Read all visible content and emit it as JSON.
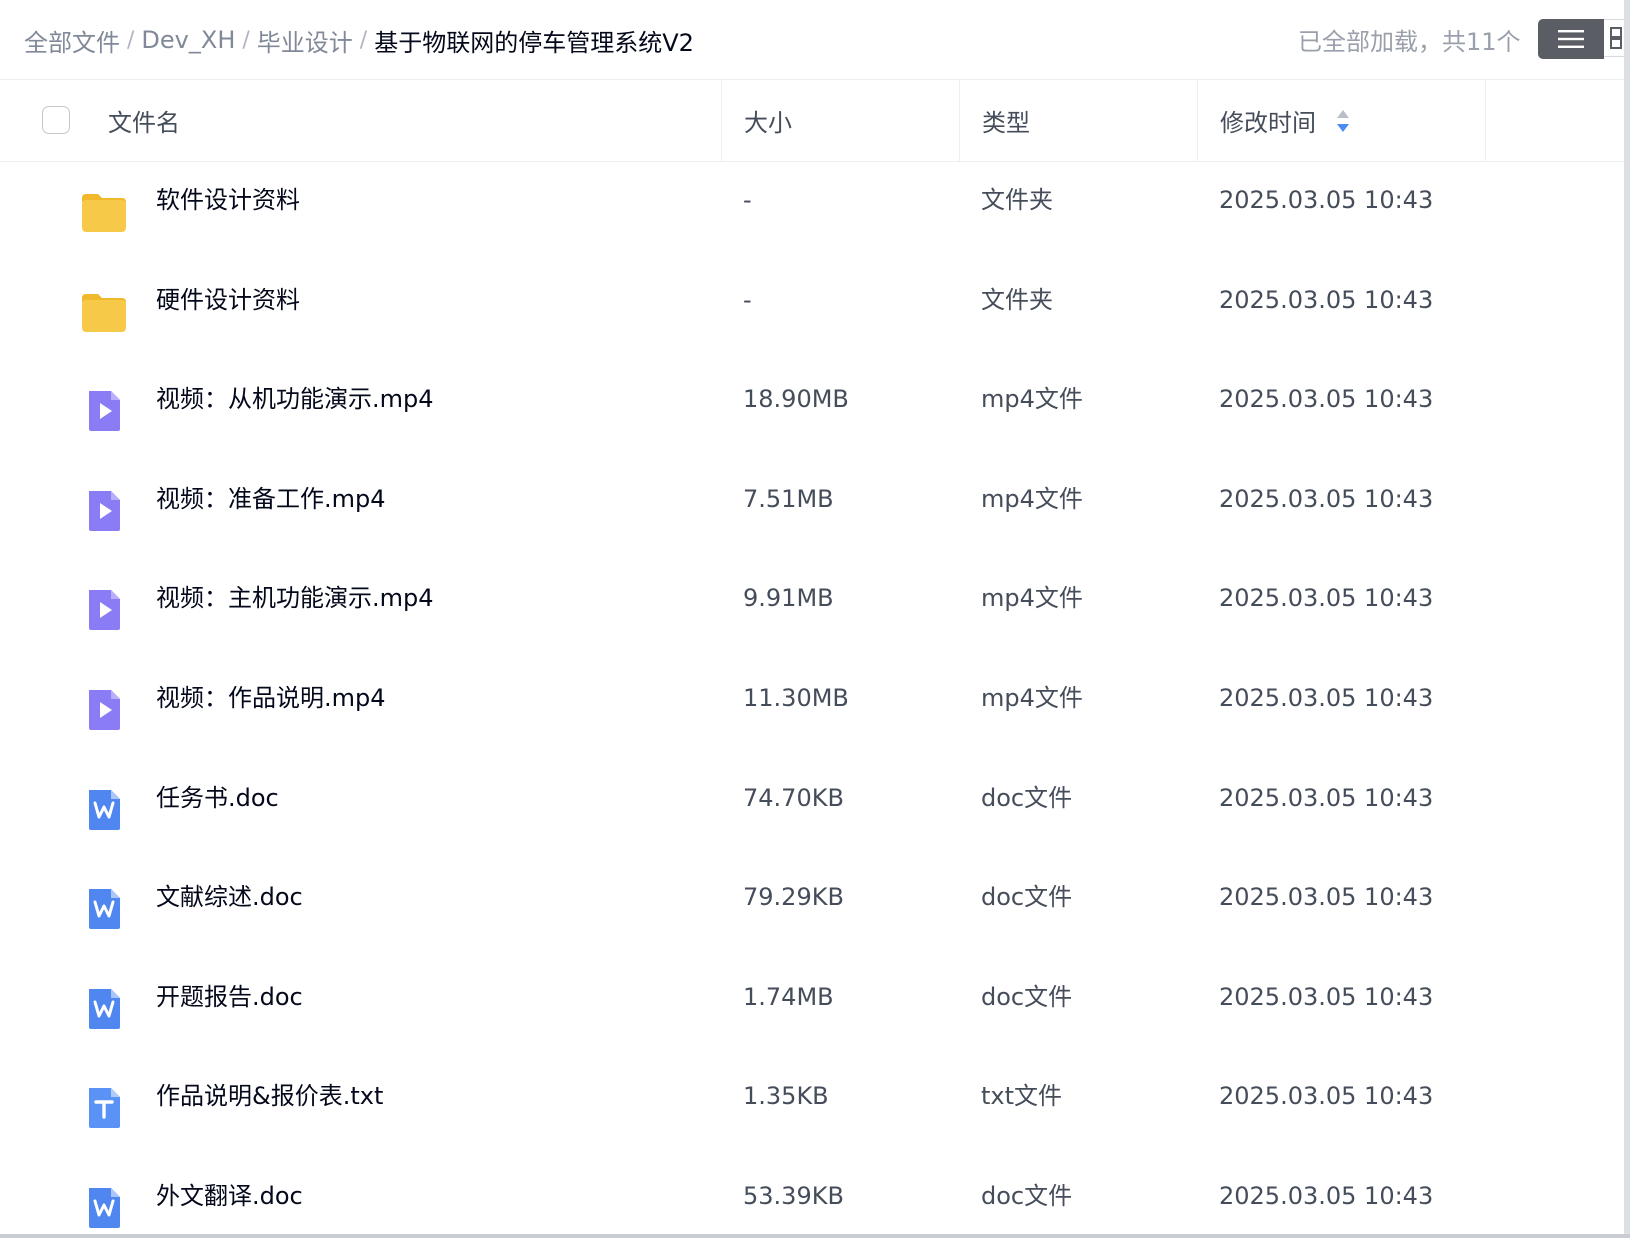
{
  "breadcrumb": [
    {
      "label": "全部文件"
    },
    {
      "label": "Dev_XH"
    },
    {
      "label": "毕业设计"
    },
    {
      "label": "基于物联网的停车管理系统V2"
    }
  ],
  "breadcrumb_separator": "/",
  "load_status": "已全部加载，共11个",
  "columns": {
    "name": "文件名",
    "size": "大小",
    "type": "类型",
    "modified": "修改时间"
  },
  "colors": {
    "folder": "#f7c948",
    "video": "#8a7cf5",
    "doc": "#4f86f0",
    "txt": "#5a93f5",
    "sort_active": "#4a8cf7"
  },
  "files": [
    {
      "name": "软件设计资料",
      "size": "-",
      "type": "文件夹",
      "modified": "2025.03.05 10:43",
      "icon": "folder-icon"
    },
    {
      "name": "硬件设计资料",
      "size": "-",
      "type": "文件夹",
      "modified": "2025.03.05 10:43",
      "icon": "folder-icon"
    },
    {
      "name": "视频：从机功能演示.mp4",
      "size": "18.90MB",
      "type": "mp4文件",
      "modified": "2025.03.05 10:43",
      "icon": "video-file-icon"
    },
    {
      "name": "视频：准备工作.mp4",
      "size": "7.51MB",
      "type": "mp4文件",
      "modified": "2025.03.05 10:43",
      "icon": "video-file-icon"
    },
    {
      "name": "视频：主机功能演示.mp4",
      "size": "9.91MB",
      "type": "mp4文件",
      "modified": "2025.03.05 10:43",
      "icon": "video-file-icon"
    },
    {
      "name": "视频：作品说明.mp4",
      "size": "11.30MB",
      "type": "mp4文件",
      "modified": "2025.03.05 10:43",
      "icon": "video-file-icon"
    },
    {
      "name": "任务书.doc",
      "size": "74.70KB",
      "type": "doc文件",
      "modified": "2025.03.05 10:43",
      "icon": "word-file-icon"
    },
    {
      "name": "文献综述.doc",
      "size": "79.29KB",
      "type": "doc文件",
      "modified": "2025.03.05 10:43",
      "icon": "word-file-icon"
    },
    {
      "name": "开题报告.doc",
      "size": "1.74MB",
      "type": "doc文件",
      "modified": "2025.03.05 10:43",
      "icon": "word-file-icon"
    },
    {
      "name": "作品说明&报价表.txt",
      "size": "1.35KB",
      "type": "txt文件",
      "modified": "2025.03.05 10:43",
      "icon": "text-file-icon"
    },
    {
      "name": "外文翻译.doc",
      "size": "53.39KB",
      "type": "doc文件",
      "modified": "2025.03.05 10:43",
      "icon": "word-file-icon"
    }
  ]
}
